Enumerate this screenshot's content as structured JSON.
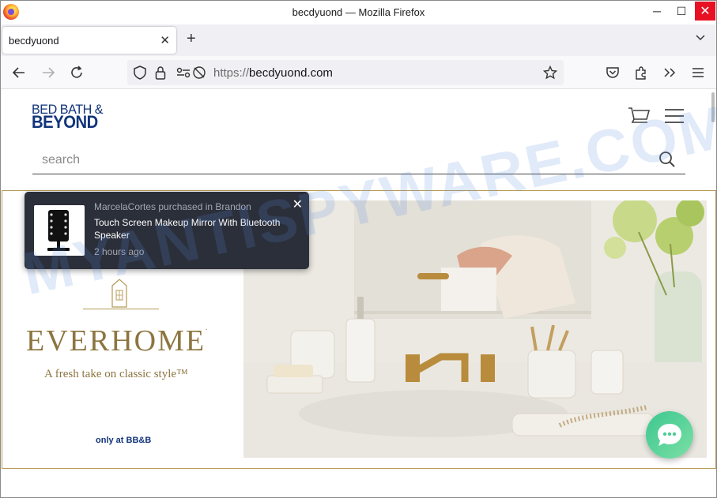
{
  "window": {
    "title": "becdyuond — Mozilla Firefox",
    "minimize_glyph": "─",
    "maximize_glyph": "☐",
    "close_glyph": "✕"
  },
  "tabs": [
    {
      "title": "becdyuond",
      "close_glyph": "✕"
    }
  ],
  "new_tab_glyph": "+",
  "urlbar": {
    "scheme": "https://",
    "host": "becdyuond.com"
  },
  "site": {
    "logo_line1": "BED BATH &",
    "logo_line2": "BEYOND",
    "search_placeholder": "search",
    "brand_color": "#11347a"
  },
  "banner": {
    "brand": "EVERHOME",
    "trademark": ".",
    "tagline": "A fresh take on classic style™",
    "only_at": "only at BB&B",
    "accent_color": "#b59a55"
  },
  "popup": {
    "buyer_text": "MarcelaCortes purchased in Brandon",
    "product": "Touch Screen Makeup Mirror With Bluetooth Speaker",
    "time": "2 hours ago",
    "close_glyph": "✕"
  },
  "watermark": "MYANTISPYWARE.COM"
}
